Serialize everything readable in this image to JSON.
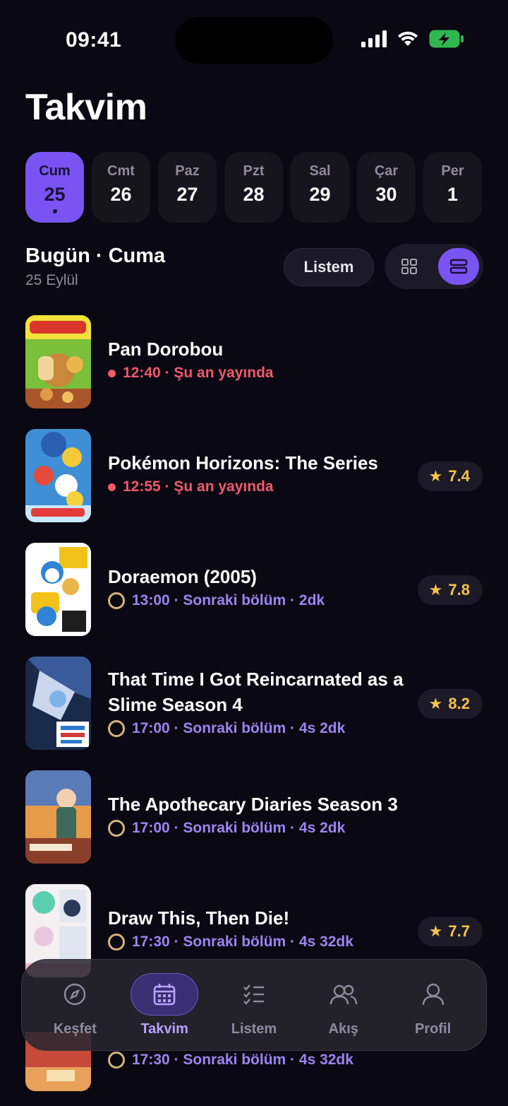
{
  "status_bar": {
    "time": "09:41"
  },
  "page": {
    "title": "Takvim"
  },
  "days": [
    {
      "name": "Cum",
      "num": "25"
    },
    {
      "name": "Cmt",
      "num": "26"
    },
    {
      "name": "Paz",
      "num": "27"
    },
    {
      "name": "Pzt",
      "num": "28"
    },
    {
      "name": "Sal",
      "num": "29"
    },
    {
      "name": "Çar",
      "num": "30"
    },
    {
      "name": "Per",
      "num": "1"
    }
  ],
  "header": {
    "today": "Bugün · Cuma",
    "date": "25 Eylül",
    "listem_button": "Listem"
  },
  "anime": [
    {
      "title": "Pan Dorobou",
      "status": "12:40 · Şu an yayında"
    },
    {
      "title": "Pokémon Horizons: The Series",
      "status": "12:55 · Şu an yayında",
      "rating": "7.4"
    },
    {
      "title": "Doraemon (2005)",
      "status": "13:00 · Sonraki bölüm · 2dk",
      "rating": "7.8"
    },
    {
      "title": "That Time I Got Reincarnated as a Slime Season 4",
      "status": "17:00 · Sonraki bölüm · 4s 2dk",
      "rating": "8.2"
    },
    {
      "title": "The Apothecary Diaries Season 3",
      "status": "17:00 · Sonraki bölüm · 4s 2dk"
    },
    {
      "title": "Draw This, Then Die!",
      "status": "17:30 · Sonraki bölüm · 4s 32dk",
      "rating": "7.7"
    },
    {
      "status": "17:30 · Sonraki bölüm · 4s 32dk"
    }
  ],
  "tabs": [
    {
      "label": "Keşfet",
      "icon": "compass-icon"
    },
    {
      "label": "Takvim",
      "icon": "calendar-icon"
    },
    {
      "label": "Listem",
      "icon": "checklist-icon"
    },
    {
      "label": "Akış",
      "icon": "users-icon"
    },
    {
      "label": "Profil",
      "icon": "user-icon"
    }
  ],
  "colors": {
    "accent": "#7a54f2",
    "live": "#ef5a6b",
    "next": "#9a86f0",
    "rating": "#f6c34a",
    "background": "#0a0812"
  }
}
